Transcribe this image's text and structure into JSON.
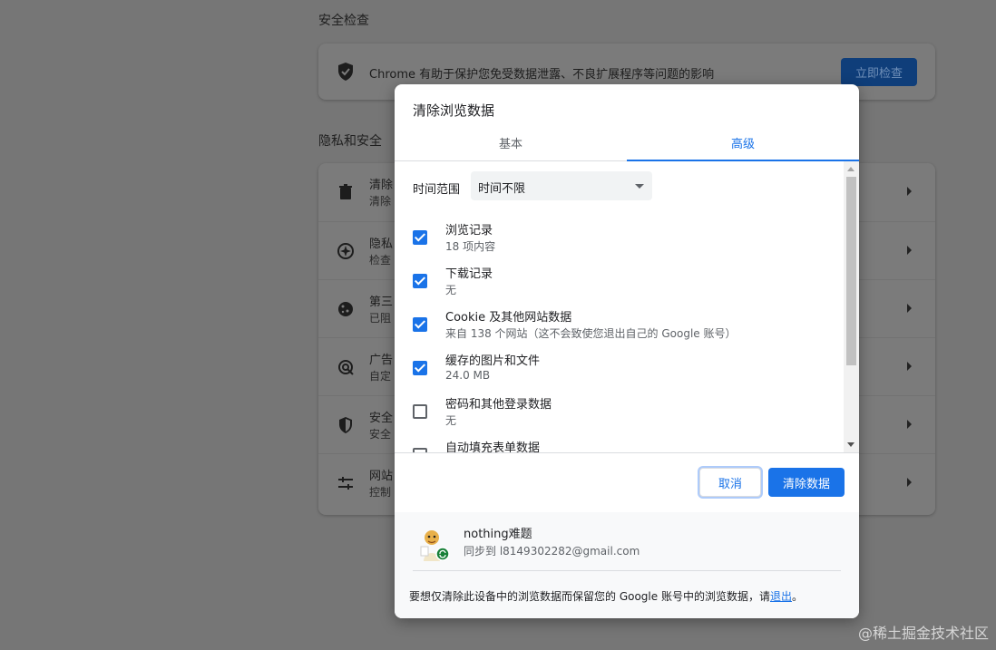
{
  "background": {
    "safety_title": "安全检查",
    "safety_desc": "Chrome 有助于保护您免受数据泄露、不良扩展程序等问题的影响",
    "safety_button": "立即检查",
    "privacy_title": "隐私和安全",
    "rows": [
      {
        "title": "清除",
        "sub": "清除",
        "icon": "trash-icon"
      },
      {
        "title": "隐私",
        "sub": "检查",
        "icon": "compass-icon"
      },
      {
        "title": "第三",
        "sub": "已阻",
        "icon": "cookie-icon"
      },
      {
        "title": "广告",
        "sub": "自定",
        "icon": "ads-icon"
      },
      {
        "title": "安全",
        "sub": "安全",
        "icon": "shield-icon"
      },
      {
        "title": "网站",
        "sub": "控制",
        "icon": "tune-icon"
      }
    ]
  },
  "dialog": {
    "title": "清除浏览数据",
    "tabs": {
      "basic": "基本",
      "advanced": "高级"
    },
    "time_range_label": "时间范围",
    "time_range_value": "时间不限",
    "items": [
      {
        "label": "浏览记录",
        "sub": "18 项内容",
        "checked": true
      },
      {
        "label": "下载记录",
        "sub": "无",
        "checked": true
      },
      {
        "label": "Cookie 及其他网站数据",
        "sub": "来自 138 个网站（这不会致使您退出自己的 Google 账号）",
        "checked": true
      },
      {
        "label": "缓存的图片和文件",
        "sub": "24.0 MB",
        "checked": true
      },
      {
        "label": "密码和其他登录数据",
        "sub": "无",
        "checked": false
      },
      {
        "label": "自动填充表单数据",
        "sub": "",
        "checked": false
      }
    ],
    "cancel_label": "取消",
    "clear_label": "清除数据",
    "account": {
      "name": "nothing难题",
      "sync": "同步到 l8149302282@gmail.com"
    },
    "footnote_prefix": "要想仅清除此设备中的浏览数据而保留您的 Google 账号中的浏览数据，请",
    "footnote_link": "退出",
    "footnote_suffix": "。"
  },
  "watermark": "@稀土掘金技术社区",
  "colors": {
    "accent": "#1a73e8",
    "overlay": "#767676",
    "sync_badge": "#188038"
  }
}
